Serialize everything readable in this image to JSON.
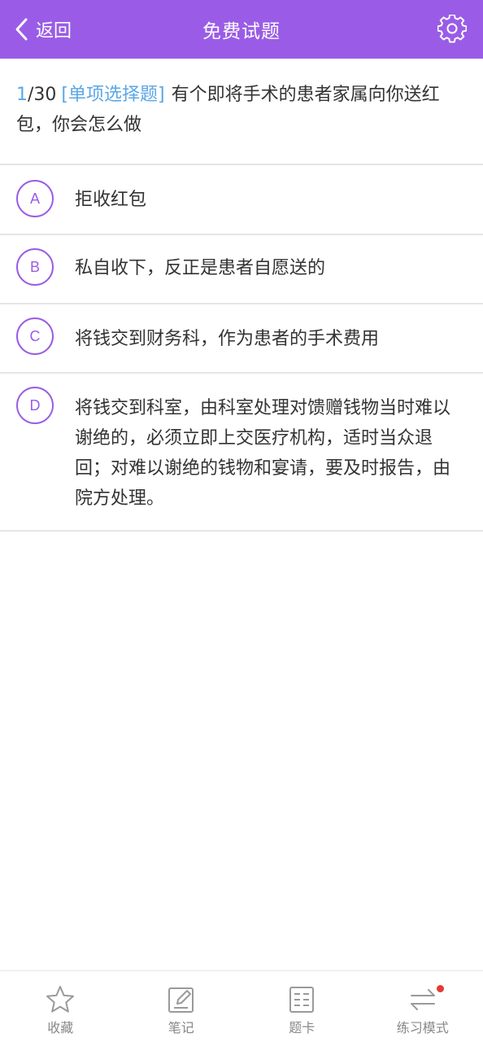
{
  "header": {
    "back_label": "返回",
    "title": "免费试题",
    "accent_color": "#9a5ce6"
  },
  "question": {
    "index": "1",
    "total": "/30",
    "type": "[单项选择题]",
    "text": "有个即将手术的患者家属向你送红包，你会怎么做"
  },
  "options": [
    {
      "letter": "A",
      "text": "拒收红包"
    },
    {
      "letter": "B",
      "text": "私自收下，反正是患者自愿送的"
    },
    {
      "letter": "C",
      "text": "将钱交到财务科，作为患者的手术费用"
    },
    {
      "letter": "D",
      "text": "将钱交到科室，由科室处理对馈赠钱物当时难以谢绝的，必须立即上交医疗机构，适时当众退回；对难以谢绝的钱物和宴请，要及时报告，由院方处理。"
    }
  ],
  "bottom_nav": {
    "favorite": {
      "label": "收藏",
      "icon": "star-icon"
    },
    "notes": {
      "label": "笔记",
      "icon": "edit-note-icon"
    },
    "answer_card": {
      "label": "题卡",
      "icon": "list-card-icon"
    },
    "practice_mode": {
      "label": "练习模式",
      "icon": "switch-arrows-icon",
      "has_badge": true
    }
  }
}
